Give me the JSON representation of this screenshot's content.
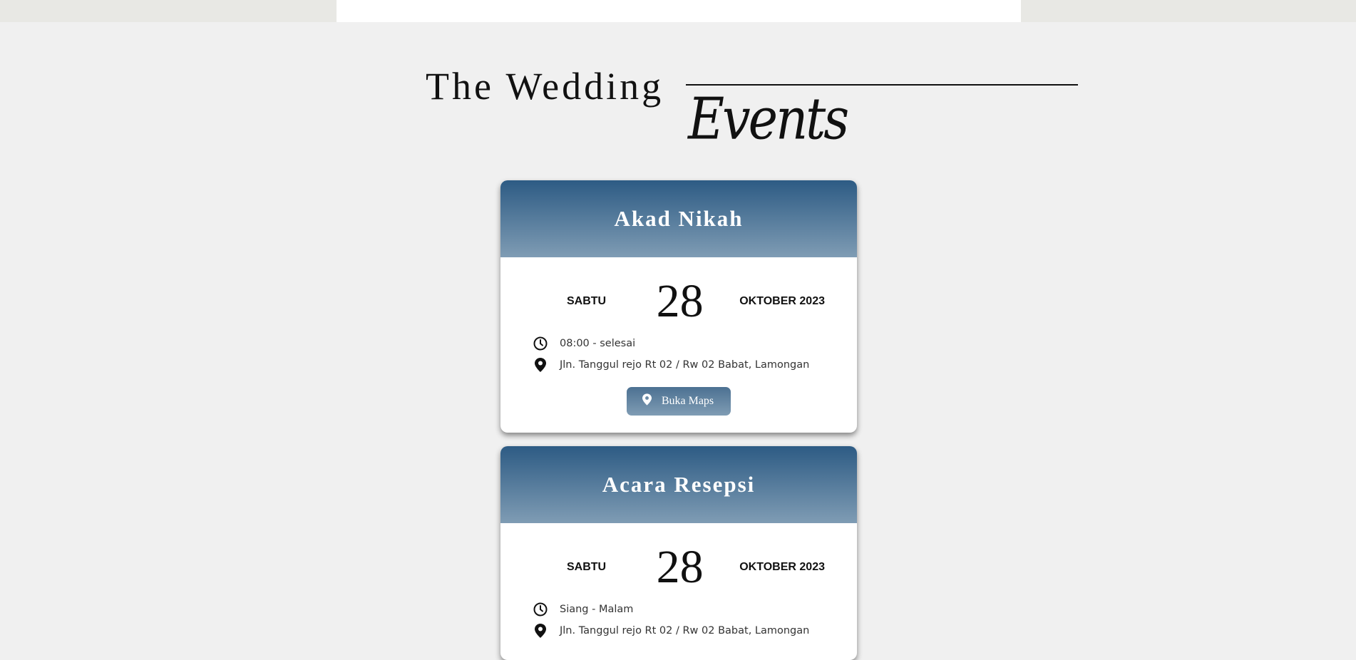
{
  "heading": {
    "title": "The Wedding",
    "subtitle": "Events"
  },
  "events": [
    {
      "title": "Akad Nikah",
      "day": "SABTU",
      "date": "28",
      "month_year": "OKTOBER 2023",
      "time": "08:00 - selesai",
      "address": "Jln. Tanggul rejo Rt 02 / Rw 02 Babat, Lamongan",
      "maps_label": "Buka Maps"
    },
    {
      "title": "Acara Resepsi",
      "day": "SABTU",
      "date": "28",
      "month_year": "OKTOBER 2023",
      "time": "Siang - Malam",
      "address": "Jln. Tanggul rejo Rt 02 / Rw 02 Babat, Lamongan"
    }
  ],
  "colors": {
    "header_top": "#2d5b84",
    "header_bottom": "#7f9cb4",
    "background": "#f0f0f0"
  },
  "icons": {
    "time": "clock-icon",
    "location": "map-pin-icon"
  }
}
